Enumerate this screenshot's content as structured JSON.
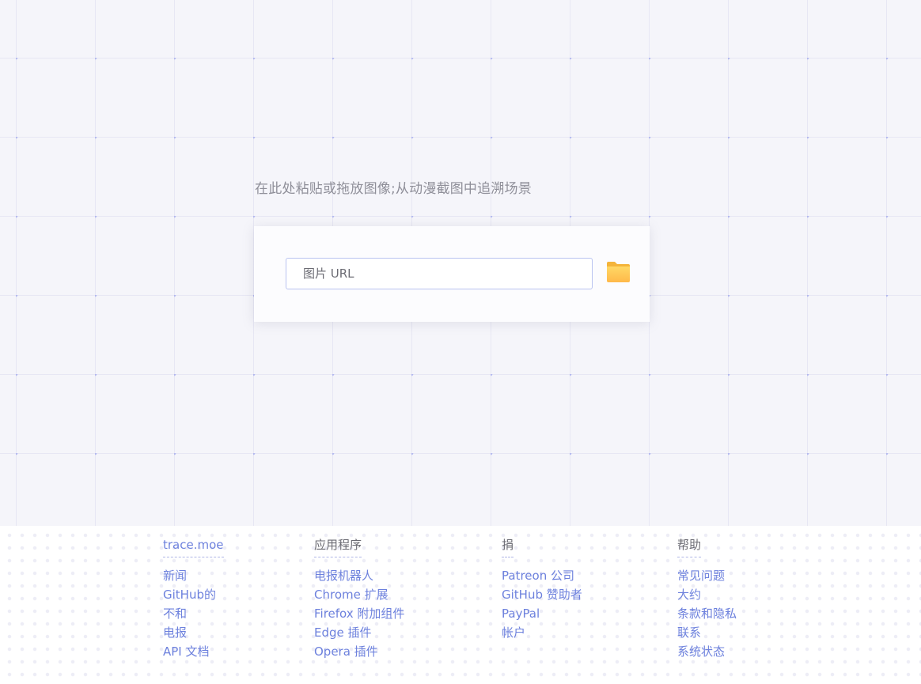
{
  "prompt": "在此处粘贴或拖放图像;从动漫截图中追溯场景",
  "search": {
    "placeholder": "图片 URL",
    "value": ""
  },
  "icons": {
    "folder": "folder-icon"
  },
  "colors": {
    "accent": "#6d81dd",
    "folder": "#ffc94d",
    "background": "#f5f5fa"
  },
  "footer": {
    "columns": [
      {
        "heading": "trace.moe",
        "heading_is_link": true,
        "links": [
          "新闻",
          "GitHub的",
          "不和",
          "电报",
          "API 文档"
        ]
      },
      {
        "heading": "应用程序",
        "heading_is_link": false,
        "links": [
          "电报机器人",
          "Chrome 扩展",
          "Firefox 附加组件",
          "Edge 插件",
          "Opera 插件"
        ]
      },
      {
        "heading": "捐",
        "heading_is_link": false,
        "links": [
          "Patreon 公司",
          "GitHub 赞助者",
          "PayPal",
          "帐户"
        ]
      },
      {
        "heading": "帮助",
        "heading_is_link": false,
        "links": [
          "常见问题",
          "大约",
          "条款和隐私",
          "联系",
          "系统状态"
        ]
      }
    ]
  }
}
